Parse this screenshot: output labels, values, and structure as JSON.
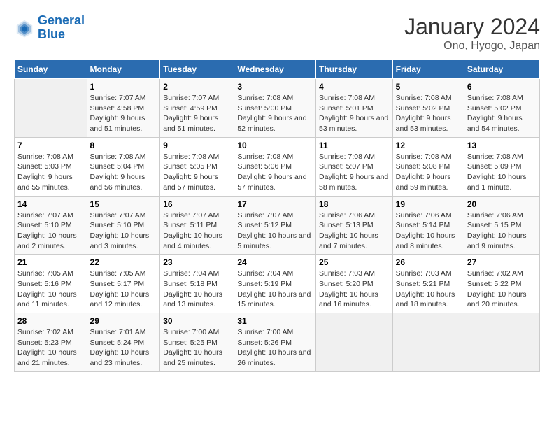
{
  "header": {
    "logo_line1": "General",
    "logo_line2": "Blue",
    "title": "January 2024",
    "subtitle": "Ono, Hyogo, Japan"
  },
  "weekdays": [
    "Sunday",
    "Monday",
    "Tuesday",
    "Wednesday",
    "Thursday",
    "Friday",
    "Saturday"
  ],
  "weeks": [
    [
      {
        "day": "",
        "sunrise": "",
        "sunset": "",
        "daylight": ""
      },
      {
        "day": "1",
        "sunrise": "Sunrise: 7:07 AM",
        "sunset": "Sunset: 4:58 PM",
        "daylight": "Daylight: 9 hours and 51 minutes."
      },
      {
        "day": "2",
        "sunrise": "Sunrise: 7:07 AM",
        "sunset": "Sunset: 4:59 PM",
        "daylight": "Daylight: 9 hours and 51 minutes."
      },
      {
        "day": "3",
        "sunrise": "Sunrise: 7:08 AM",
        "sunset": "Sunset: 5:00 PM",
        "daylight": "Daylight: 9 hours and 52 minutes."
      },
      {
        "day": "4",
        "sunrise": "Sunrise: 7:08 AM",
        "sunset": "Sunset: 5:01 PM",
        "daylight": "Daylight: 9 hours and 53 minutes."
      },
      {
        "day": "5",
        "sunrise": "Sunrise: 7:08 AM",
        "sunset": "Sunset: 5:02 PM",
        "daylight": "Daylight: 9 hours and 53 minutes."
      },
      {
        "day": "6",
        "sunrise": "Sunrise: 7:08 AM",
        "sunset": "Sunset: 5:02 PM",
        "daylight": "Daylight: 9 hours and 54 minutes."
      }
    ],
    [
      {
        "day": "7",
        "sunrise": "Sunrise: 7:08 AM",
        "sunset": "Sunset: 5:03 PM",
        "daylight": "Daylight: 9 hours and 55 minutes."
      },
      {
        "day": "8",
        "sunrise": "Sunrise: 7:08 AM",
        "sunset": "Sunset: 5:04 PM",
        "daylight": "Daylight: 9 hours and 56 minutes."
      },
      {
        "day": "9",
        "sunrise": "Sunrise: 7:08 AM",
        "sunset": "Sunset: 5:05 PM",
        "daylight": "Daylight: 9 hours and 57 minutes."
      },
      {
        "day": "10",
        "sunrise": "Sunrise: 7:08 AM",
        "sunset": "Sunset: 5:06 PM",
        "daylight": "Daylight: 9 hours and 57 minutes."
      },
      {
        "day": "11",
        "sunrise": "Sunrise: 7:08 AM",
        "sunset": "Sunset: 5:07 PM",
        "daylight": "Daylight: 9 hours and 58 minutes."
      },
      {
        "day": "12",
        "sunrise": "Sunrise: 7:08 AM",
        "sunset": "Sunset: 5:08 PM",
        "daylight": "Daylight: 9 hours and 59 minutes."
      },
      {
        "day": "13",
        "sunrise": "Sunrise: 7:08 AM",
        "sunset": "Sunset: 5:09 PM",
        "daylight": "Daylight: 10 hours and 1 minute."
      }
    ],
    [
      {
        "day": "14",
        "sunrise": "Sunrise: 7:07 AM",
        "sunset": "Sunset: 5:10 PM",
        "daylight": "Daylight: 10 hours and 2 minutes."
      },
      {
        "day": "15",
        "sunrise": "Sunrise: 7:07 AM",
        "sunset": "Sunset: 5:10 PM",
        "daylight": "Daylight: 10 hours and 3 minutes."
      },
      {
        "day": "16",
        "sunrise": "Sunrise: 7:07 AM",
        "sunset": "Sunset: 5:11 PM",
        "daylight": "Daylight: 10 hours and 4 minutes."
      },
      {
        "day": "17",
        "sunrise": "Sunrise: 7:07 AM",
        "sunset": "Sunset: 5:12 PM",
        "daylight": "Daylight: 10 hours and 5 minutes."
      },
      {
        "day": "18",
        "sunrise": "Sunrise: 7:06 AM",
        "sunset": "Sunset: 5:13 PM",
        "daylight": "Daylight: 10 hours and 7 minutes."
      },
      {
        "day": "19",
        "sunrise": "Sunrise: 7:06 AM",
        "sunset": "Sunset: 5:14 PM",
        "daylight": "Daylight: 10 hours and 8 minutes."
      },
      {
        "day": "20",
        "sunrise": "Sunrise: 7:06 AM",
        "sunset": "Sunset: 5:15 PM",
        "daylight": "Daylight: 10 hours and 9 minutes."
      }
    ],
    [
      {
        "day": "21",
        "sunrise": "Sunrise: 7:05 AM",
        "sunset": "Sunset: 5:16 PM",
        "daylight": "Daylight: 10 hours and 11 minutes."
      },
      {
        "day": "22",
        "sunrise": "Sunrise: 7:05 AM",
        "sunset": "Sunset: 5:17 PM",
        "daylight": "Daylight: 10 hours and 12 minutes."
      },
      {
        "day": "23",
        "sunrise": "Sunrise: 7:04 AM",
        "sunset": "Sunset: 5:18 PM",
        "daylight": "Daylight: 10 hours and 13 minutes."
      },
      {
        "day": "24",
        "sunrise": "Sunrise: 7:04 AM",
        "sunset": "Sunset: 5:19 PM",
        "daylight": "Daylight: 10 hours and 15 minutes."
      },
      {
        "day": "25",
        "sunrise": "Sunrise: 7:03 AM",
        "sunset": "Sunset: 5:20 PM",
        "daylight": "Daylight: 10 hours and 16 minutes."
      },
      {
        "day": "26",
        "sunrise": "Sunrise: 7:03 AM",
        "sunset": "Sunset: 5:21 PM",
        "daylight": "Daylight: 10 hours and 18 minutes."
      },
      {
        "day": "27",
        "sunrise": "Sunrise: 7:02 AM",
        "sunset": "Sunset: 5:22 PM",
        "daylight": "Daylight: 10 hours and 20 minutes."
      }
    ],
    [
      {
        "day": "28",
        "sunrise": "Sunrise: 7:02 AM",
        "sunset": "Sunset: 5:23 PM",
        "daylight": "Daylight: 10 hours and 21 minutes."
      },
      {
        "day": "29",
        "sunrise": "Sunrise: 7:01 AM",
        "sunset": "Sunset: 5:24 PM",
        "daylight": "Daylight: 10 hours and 23 minutes."
      },
      {
        "day": "30",
        "sunrise": "Sunrise: 7:00 AM",
        "sunset": "Sunset: 5:25 PM",
        "daylight": "Daylight: 10 hours and 25 minutes."
      },
      {
        "day": "31",
        "sunrise": "Sunrise: 7:00 AM",
        "sunset": "Sunset: 5:26 PM",
        "daylight": "Daylight: 10 hours and 26 minutes."
      },
      {
        "day": "",
        "sunrise": "",
        "sunset": "",
        "daylight": ""
      },
      {
        "day": "",
        "sunrise": "",
        "sunset": "",
        "daylight": ""
      },
      {
        "day": "",
        "sunrise": "",
        "sunset": "",
        "daylight": ""
      }
    ]
  ]
}
